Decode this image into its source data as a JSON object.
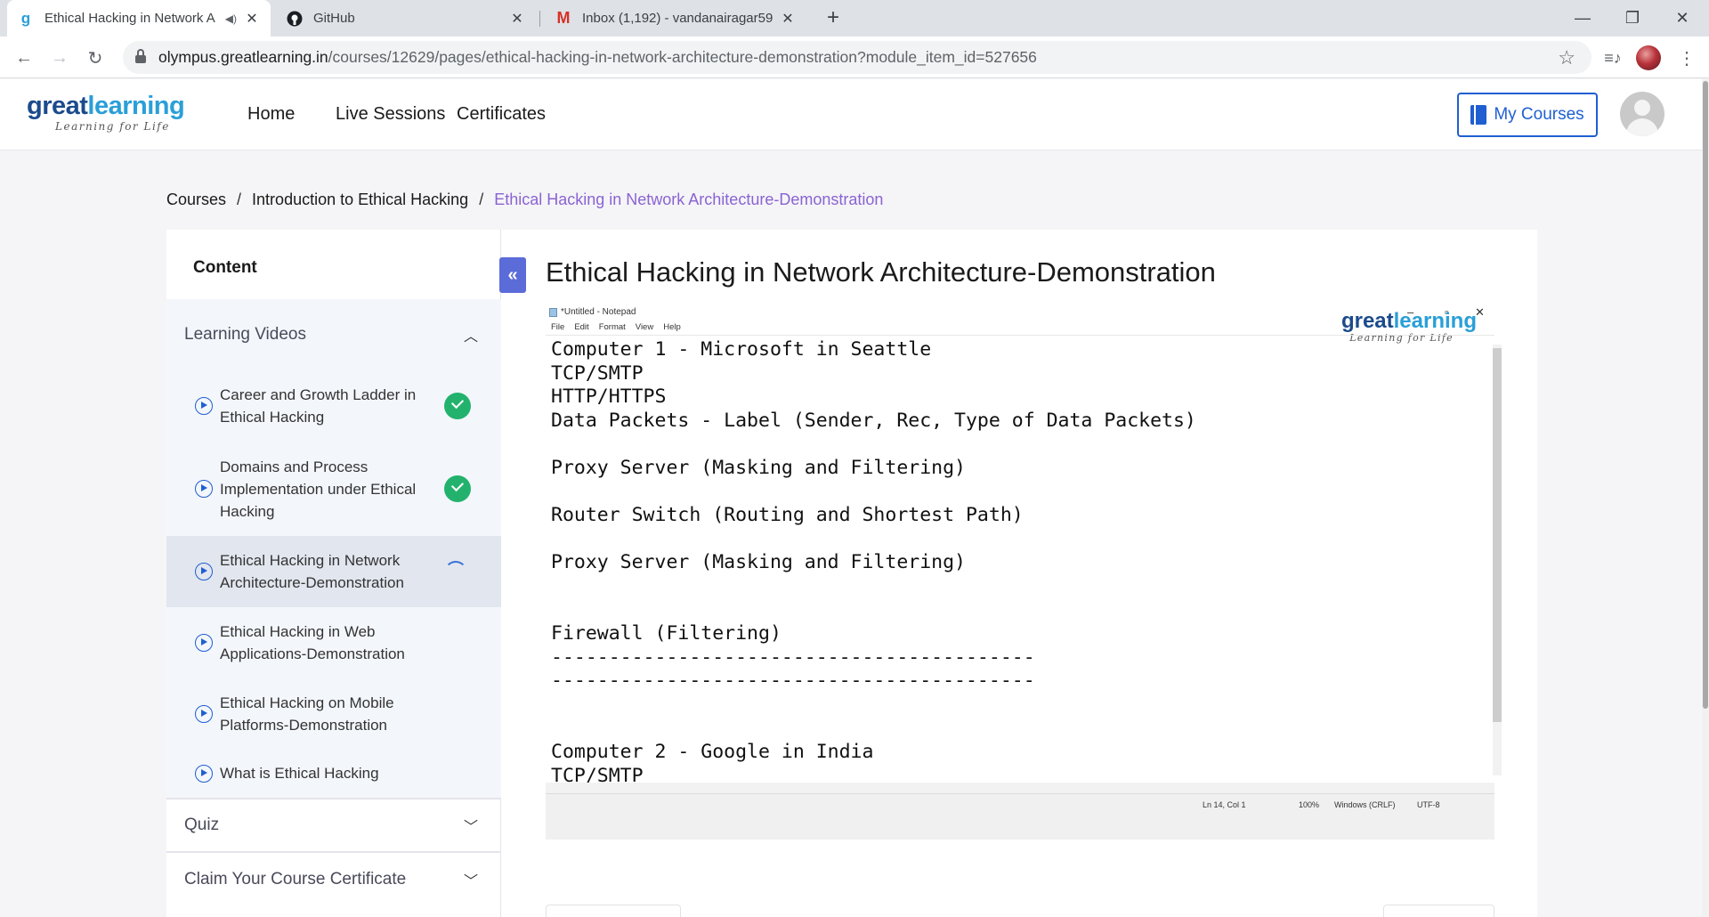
{
  "browser": {
    "tabs": [
      {
        "title": "Ethical Hacking in Network A",
        "favicon": "gl-logo-icon",
        "active": true
      },
      {
        "title": "GitHub",
        "favicon": "github-icon",
        "active": false
      },
      {
        "title": "Inbox (1,192) - vandanairagar59",
        "favicon": "gmail-icon",
        "active": false
      }
    ],
    "url_host": "olympus.greatlearning.in",
    "url_path": "/courses/12629/pages/ethical-hacking-in-network-architecture-demonstration?module_item_id=527656"
  },
  "header": {
    "logo_great": "great",
    "logo_learning": "learning",
    "logo_tagline": "Learning for Life",
    "nav": [
      "Home",
      "Live Sessions",
      "Certificates"
    ],
    "my_courses": "My Courses"
  },
  "breadcrumb": {
    "items": [
      "Courses",
      "Introduction to Ethical Hacking"
    ],
    "current": "Ethical Hacking in Network Architecture-Demonstration",
    "separator": "/"
  },
  "sidebar": {
    "title": "Content",
    "sections": [
      {
        "label": "Learning Videos",
        "expanded": true,
        "items": [
          {
            "label": "Career and Growth Ladder in Ethical Hacking",
            "status": "completed"
          },
          {
            "label": "Domains and Process Implementation under Ethical Hacking",
            "status": "completed"
          },
          {
            "label": "Ethical Hacking in Network Architecture-Demonstration",
            "status": "in-progress",
            "active": true
          },
          {
            "label": "Ethical Hacking in Web Applications-Demonstration",
            "status": "none"
          },
          {
            "label": "Ethical Hacking on Mobile Platforms-Demonstration",
            "status": "none"
          },
          {
            "label": "What is Ethical Hacking",
            "status": "none"
          }
        ]
      },
      {
        "label": "Quiz",
        "expanded": false
      },
      {
        "label": "Claim Your Course Certificate",
        "expanded": false
      }
    ]
  },
  "main": {
    "title": "Ethical Hacking in Network Architecture-Demonstration",
    "video": {
      "notepad_title": "*Untitled - Notepad",
      "menu": [
        "File",
        "Edit",
        "Format",
        "View",
        "Help"
      ],
      "text": "Computer 1 - Microsoft in Seattle\nTCP/SMTP\nHTTP/HTTPS\nData Packets - Label (Sender, Rec, Type of Data Packets)\n\nProxy Server (Masking and Filtering)\n\nRouter Switch (Routing and Shortest Path)\n\nProxy Server (Masking and Filtering)\n\n\nFirewall (Filtering)\n------------------------------------------\n------------------------------------------\n\n\nComputer 2 - Google in India\nTCP/SMTP",
      "status": {
        "position": "Ln 14, Col 1",
        "zoom": "100%",
        "line_endings": "Windows (CRLF)",
        "encoding": "UTF-8"
      },
      "watermark_great": "great",
      "watermark_learning": "learning",
      "watermark_tagline": "Learning for Life"
    }
  },
  "colors": {
    "brand_blue": "#1f5fd1",
    "logo_dark": "#1c4b8c",
    "logo_light": "#2a9fd8",
    "breadcrumb_current": "#8a63d2",
    "complete_green": "#23b26d",
    "collapse_button": "#5b6bd8"
  }
}
